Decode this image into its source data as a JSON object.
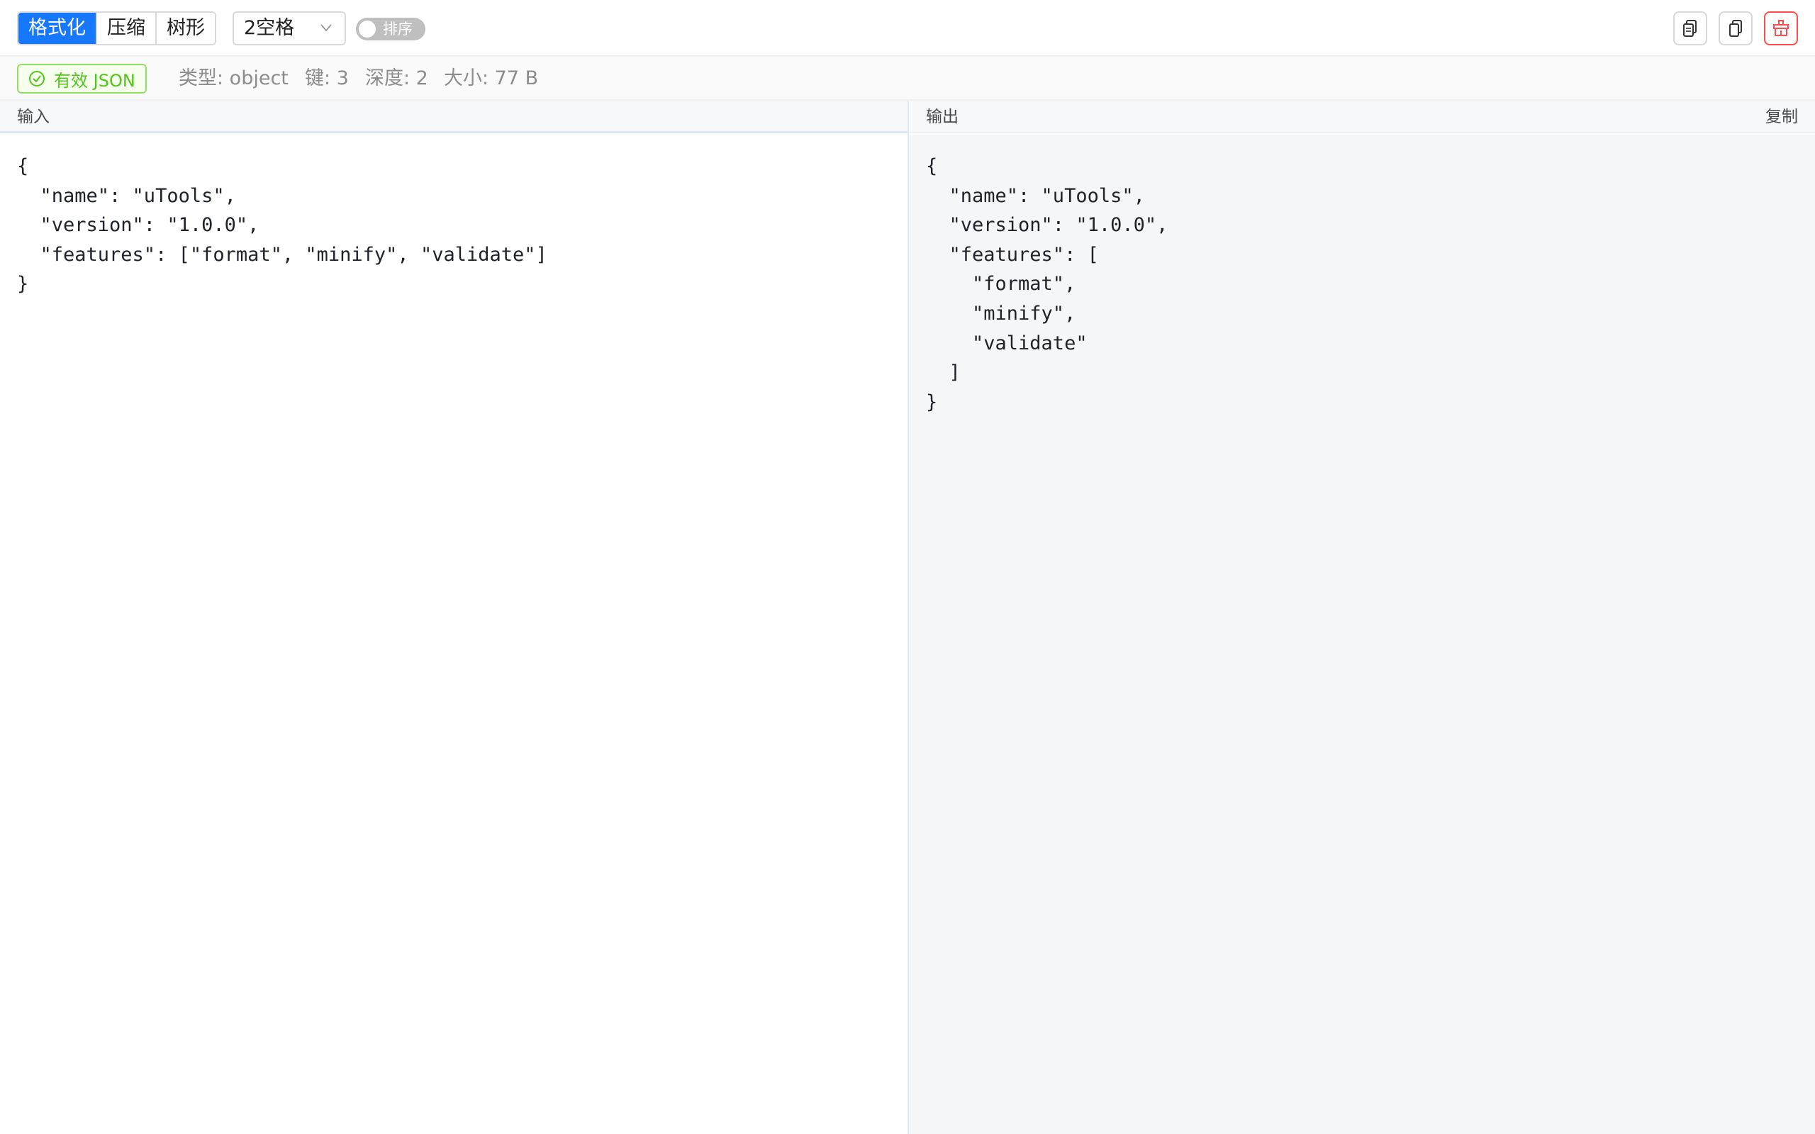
{
  "toolbar": {
    "modes": [
      "格式化",
      "压缩",
      "树形"
    ],
    "active_mode": "格式化",
    "indent_value": "2空格",
    "sort_label": "排序",
    "sort_enabled": false,
    "right_icons": [
      "copy-input-icon",
      "copy-output-icon",
      "clear-icon"
    ]
  },
  "status": {
    "valid_label": "有效 JSON",
    "type": "类型: object",
    "keys": "键: 3",
    "depth": "深度: 2",
    "size": "大小: 77 B"
  },
  "input_pane": {
    "title": "输入",
    "content": "{\n  \"name\": \"uTools\",\n  \"version\": \"1.0.0\",\n  \"features\": [\"format\", \"minify\", \"validate\"]\n}"
  },
  "output_pane": {
    "title": "输出",
    "copy_label": "复制",
    "content": "{\n  \"name\": \"uTools\",\n  \"version\": \"1.0.0\",\n  \"features\": [\n    \"format\",\n    \"minify\",\n    \"validate\"\n  ]\n}"
  },
  "colors": {
    "accent": "#1677ff",
    "valid": "#52c41a",
    "danger": "#ff4d4f"
  }
}
